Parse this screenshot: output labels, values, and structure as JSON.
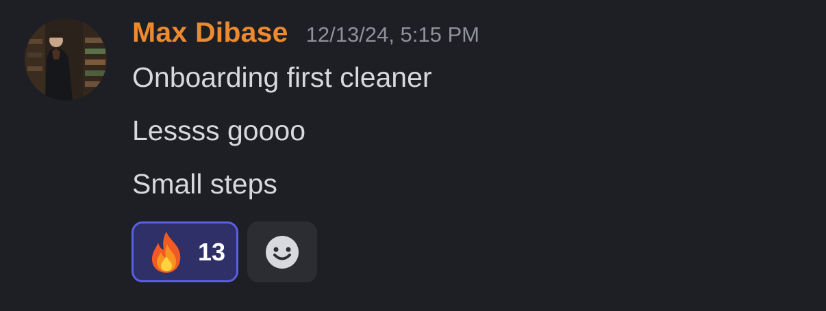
{
  "message": {
    "author": "Max Dibase",
    "timestamp": "12/13/24, 5:15 PM",
    "lines": [
      "Onboarding first cleaner",
      "Lessss goooo",
      "Small steps"
    ],
    "reactions": [
      {
        "emoji": "fire-icon",
        "count": "13",
        "selected": true
      }
    ],
    "add_reaction_icon": "smiley-icon"
  },
  "colors": {
    "background": "#1e1f24",
    "username": "#ed8a2f",
    "timestamp": "#8f929b",
    "message_text": "#d7d9de",
    "reaction_selected_bg": "#2f3068",
    "reaction_selected_border": "#5860e3",
    "add_reaction_bg": "#2c2d32"
  }
}
